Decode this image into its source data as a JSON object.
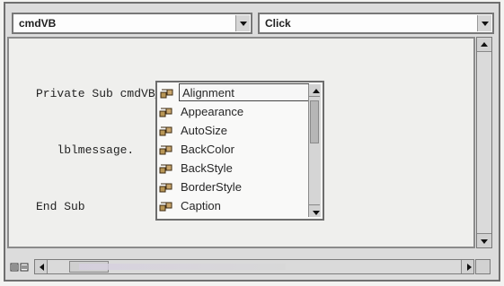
{
  "toolbar": {
    "object_combo": "cmdVB",
    "procedure_combo": "Click"
  },
  "code": {
    "lines": [
      "Private Sub cmdVB_Click()",
      "   lblmessage.",
      "End Sub"
    ]
  },
  "autocomplete": {
    "items": [
      "Alignment",
      "Appearance",
      "AutoSize",
      "BackColor",
      "BackStyle",
      "BorderStyle",
      "Caption"
    ]
  },
  "icons": {
    "dropdown": "chevron-down-icon",
    "property": "property-icon",
    "view": "view-toggle-icon"
  }
}
